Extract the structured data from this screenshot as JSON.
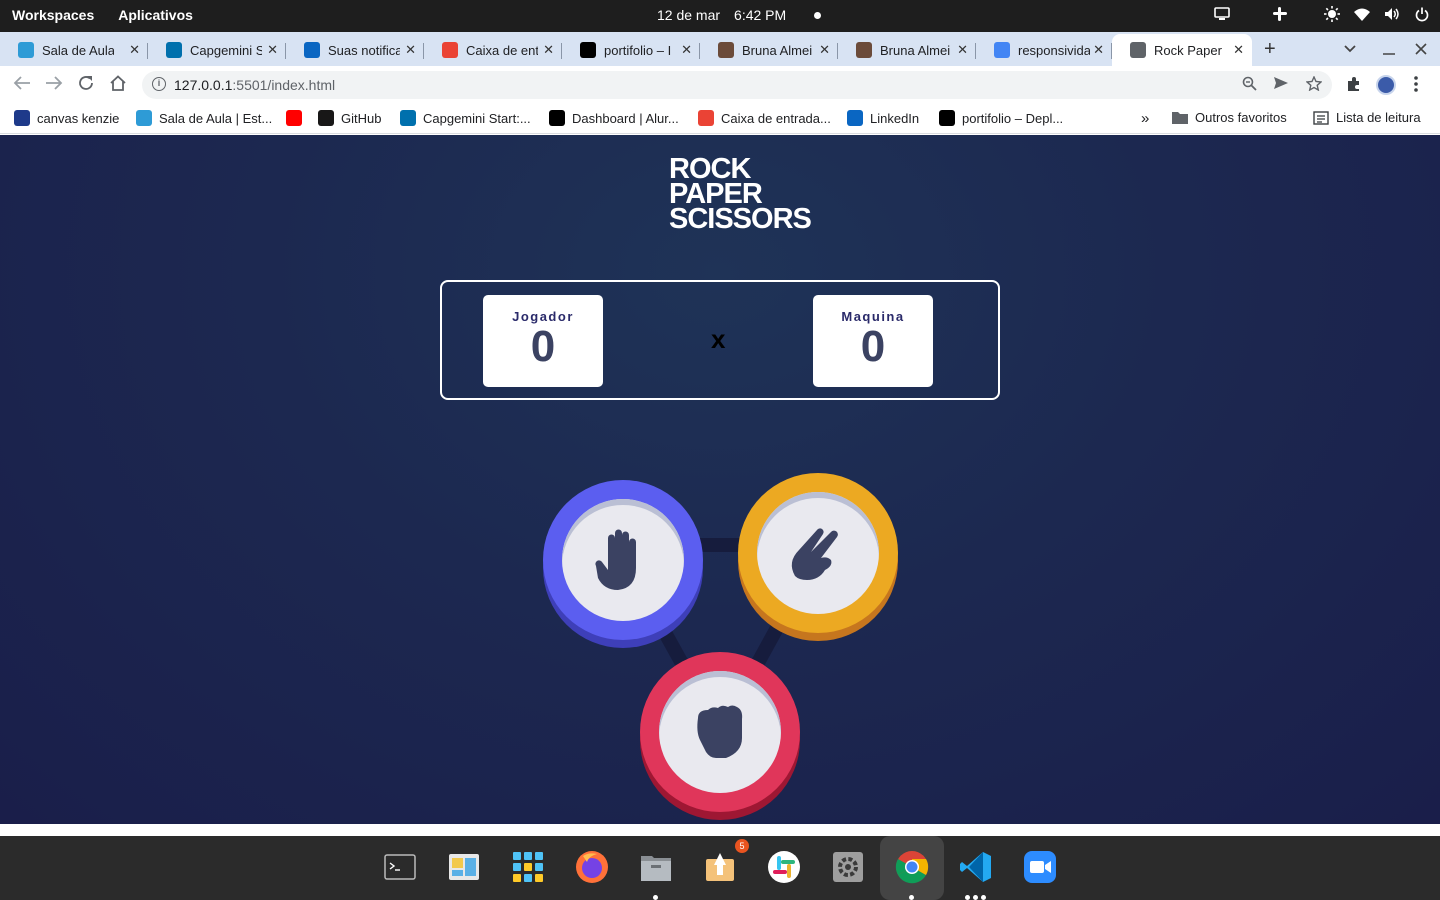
{
  "system_bar": {
    "workspaces": "Workspaces",
    "apps": "Aplicativos",
    "date": "12 de mar",
    "time": "6:42 PM"
  },
  "tabs": [
    {
      "label": "Sala de Aula",
      "icon": "tech-icon",
      "color": "#2e9bd6"
    },
    {
      "label": "Capgemini S",
      "icon": "capgemini-icon",
      "color": "#0070ad"
    },
    {
      "label": "Suas notifica",
      "icon": "linkedin-icon",
      "color": "#0a66c2"
    },
    {
      "label": "Caixa de ent",
      "icon": "gmail-icon",
      "color": "#ea4335"
    },
    {
      "label": "portifolio – I",
      "icon": "vercel-icon",
      "color": "#000000"
    },
    {
      "label": "Bruna Almei",
      "icon": "avatar-icon",
      "color": "#6b4b3a"
    },
    {
      "label": "Bruna Almei",
      "icon": "avatar-icon",
      "color": "#6b4b3a"
    },
    {
      "label": "responsivida",
      "icon": "google-icon",
      "color": "#4285f4"
    },
    {
      "label": "Rock Paper S",
      "icon": "globe-icon",
      "color": "#5f6368"
    }
  ],
  "address_bar": {
    "host": "127.0.0.1",
    "path": ":5501/index.html"
  },
  "bookmarks": [
    {
      "label": "canvas kenzie",
      "icon": "canvas-icon",
      "color": "#1e3a8a"
    },
    {
      "label": "Sala de Aula | Est...",
      "icon": "tech-icon",
      "color": "#2e9bd6"
    },
    {
      "label": "",
      "icon": "youtube-icon",
      "color": "#ff0000"
    },
    {
      "label": "GitHub",
      "icon": "github-icon",
      "color": "#181717"
    },
    {
      "label": "Capgemini Start:...",
      "icon": "capgemini-icon",
      "color": "#0070ad"
    },
    {
      "label": "Dashboard | Alur...",
      "icon": "alura-icon",
      "color": "#000000"
    },
    {
      "label": "Caixa de entrada...",
      "icon": "gmail-icon",
      "color": "#ea4335"
    },
    {
      "label": "LinkedIn",
      "icon": "linkedin-icon",
      "color": "#0a66c2"
    },
    {
      "label": "portifolio – Depl...",
      "icon": "vercel-icon",
      "color": "#000000"
    }
  ],
  "bookmarks_right": {
    "other": "Outros favoritos",
    "reading": "Lista de leitura"
  },
  "game": {
    "logo_lines": [
      "ROCK",
      "PAPER",
      "SCISSORS"
    ],
    "player": {
      "label": "Jogador",
      "score": "0"
    },
    "versus": "x",
    "machine": {
      "label": "Maquina",
      "score": "0"
    },
    "choices": [
      {
        "name": "paper",
        "icon": "hand-open-icon",
        "color": "#5b5ef0"
      },
      {
        "name": "scissors",
        "icon": "hand-scissors-icon",
        "color": "#eca922"
      },
      {
        "name": "rock",
        "icon": "hand-fist-icon",
        "color": "#e0365a"
      }
    ]
  },
  "dock": {
    "badge_count": "5",
    "apps": [
      "terminal-icon",
      "files-manager-icon",
      "app-grid-icon",
      "firefox-icon",
      "files-icon",
      "software-icon",
      "slack-icon",
      "settings-icon",
      "chrome-icon",
      "vscode-icon",
      "zoom-icon"
    ]
  }
}
